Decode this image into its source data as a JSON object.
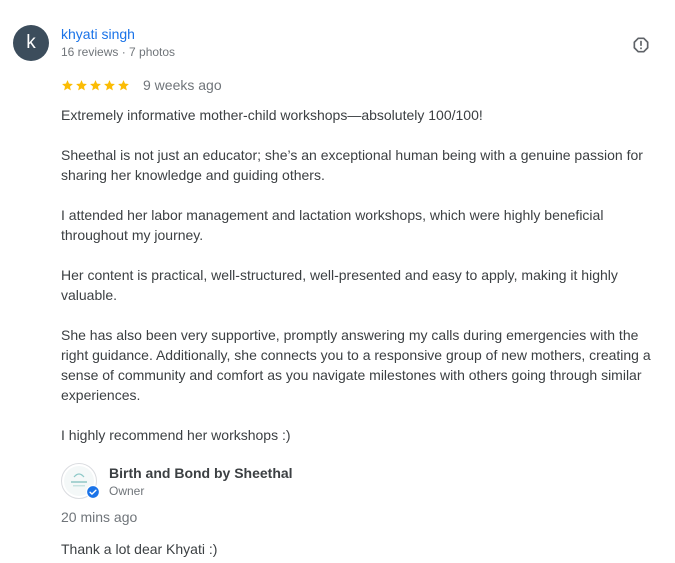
{
  "reviewer": {
    "initial": "k",
    "name": "khyati singh",
    "meta": "16 reviews · 7 photos",
    "avatar_color": "#3c4d5c"
  },
  "review": {
    "rating": 5,
    "date": "9 weeks ago",
    "paragraphs": [
      "Extremely informative mother-child workshops—absolutely 100/100!",
      "Sheethal is not just an educator; she’s an exceptional human being with a genuine passion for sharing her knowledge and guiding others.",
      "I attended her labor management and lactation workshops, which were highly beneficial throughout my journey.",
      "Her content is practical, well-structured, well-presented and easy to apply, making it highly valuable.",
      "She has also been very supportive, promptly answering my calls during emergencies with the right guidance. Additionally, she connects you to a responsive group of new mothers, creating a sense of community and comfort as you navigate milestones with others going through similar experiences.",
      "I highly recommend her workshops :)"
    ]
  },
  "owner_response": {
    "name": "Birth and Bond by Sheethal",
    "role": "Owner",
    "date": "20 mins ago",
    "text": "Thank a lot dear Khyati :)"
  },
  "colors": {
    "link": "#1a73e8",
    "star": "#fbbc04",
    "secondary_text": "#70757a",
    "verified": "#1a73e8"
  },
  "icons": {
    "report": "flag-icon",
    "star": "star-icon",
    "verified": "verified-badge-icon"
  }
}
